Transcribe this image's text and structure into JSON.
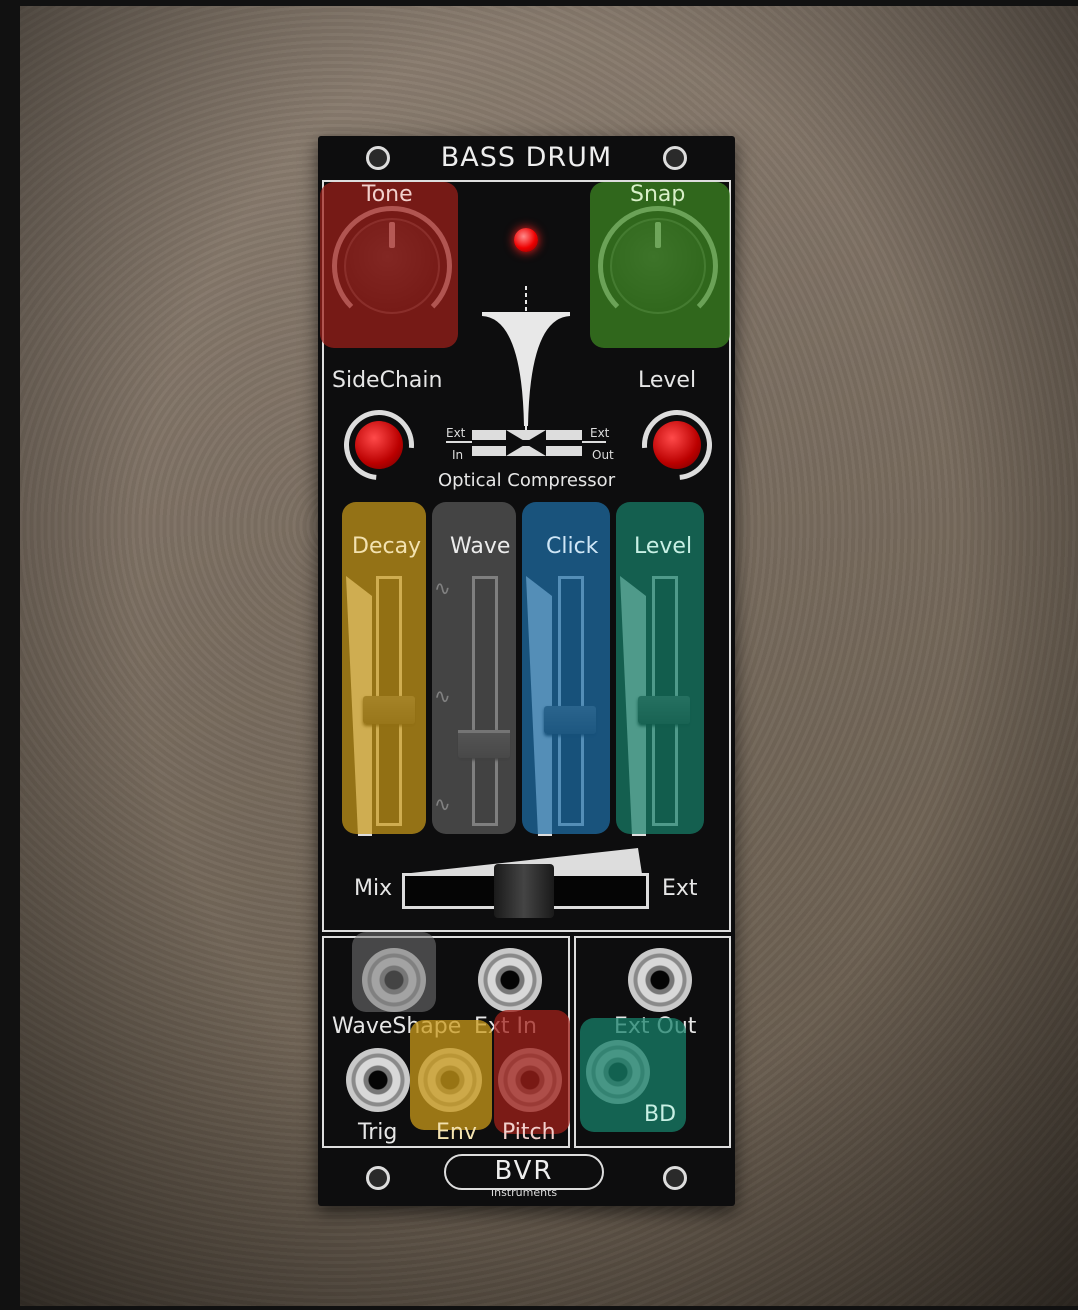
{
  "module": {
    "title": "BASS DRUM",
    "brand": {
      "mark": "BVR",
      "sub": "Instruments"
    }
  },
  "knobs": {
    "tone": "Tone",
    "snap": "Snap",
    "sidechain": "SideChain",
    "level": "Level"
  },
  "compressor": {
    "label": "Optical Compressor",
    "ext_in_top": "Ext",
    "ext_in_bottom": "In",
    "ext_out_top": "Ext",
    "ext_out_bottom": "Out"
  },
  "sliders": {
    "decay": "Decay",
    "wave": "Wave",
    "click": "Click",
    "level": "Level",
    "wave_symbols": [
      "∿",
      "∿",
      "∿"
    ]
  },
  "mix": {
    "left": "Mix",
    "right": "Ext"
  },
  "jacks": {
    "waveshape": "WaveShape",
    "ext_in": "Ext  In",
    "ext_out": "Ext  Out",
    "trig": "Trig",
    "env": "Env",
    "pitch": "Pitch",
    "bd": "BD"
  },
  "highlight_colors": {
    "red": "#a0201a",
    "green": "#3e8a22",
    "yellow": "#c99a1a",
    "gray": "#5a5a5a",
    "blue": "#1e6fa8",
    "teal": "#17806a"
  }
}
